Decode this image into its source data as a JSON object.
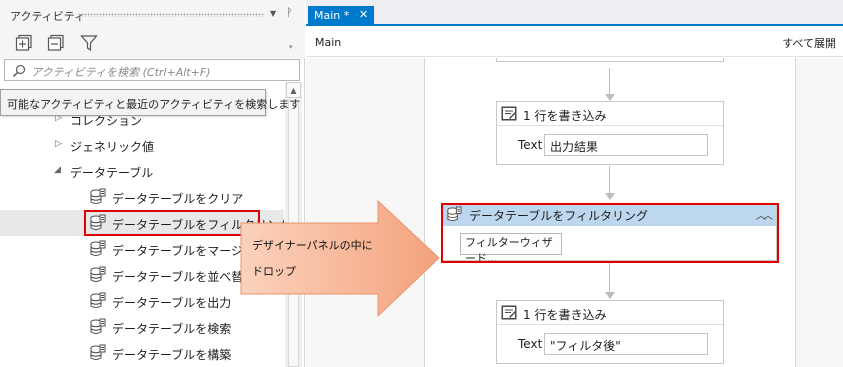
{
  "panel": {
    "title": "アクティビティ",
    "dropdown_icon": "▼",
    "pin_icon": "ф"
  },
  "toolbar": {
    "icons": [
      "expand-all-icon",
      "collapse-all-icon",
      "filter-icon"
    ]
  },
  "search": {
    "placeholder": "アクティビティを検索 (Ctrl+Alt+F)"
  },
  "tooltip": {
    "text": "可能なアクティビティと最近のアクティビティを検索します"
  },
  "tree": {
    "collection": "コレクション",
    "generic": "ジェネリック値",
    "datatable": "データテーブル",
    "items": [
      "データテーブルをクリア",
      "データテーブルをフィルタリング",
      "データテーブルをマージ",
      "データテーブルを並べ替え",
      "データテーブルを出力",
      "データテーブルを検索",
      "データテーブルを構築"
    ]
  },
  "designer": {
    "tab_label": "Main *",
    "tab_close": "✕",
    "breadcrumb": "Main",
    "expand_all": "すべて展開",
    "activities": [
      {
        "title": "1 行を書き込み",
        "field_label": "Text",
        "value": "出力結果"
      },
      {
        "title": "データテーブルをフィルタリング",
        "button": "フィルターウィザード..."
      },
      {
        "title": "1 行を書き込み",
        "field_label": "Text",
        "value": "\"フィルタ後\""
      }
    ]
  },
  "callout": {
    "line1": "デザイナーパネルの中に",
    "line2": "ドロップ",
    "fill_color": "#f6b18e"
  },
  "colors": {
    "accent": "#007acc",
    "highlight": "#e00000",
    "selected_header": "#bdd7ee"
  }
}
